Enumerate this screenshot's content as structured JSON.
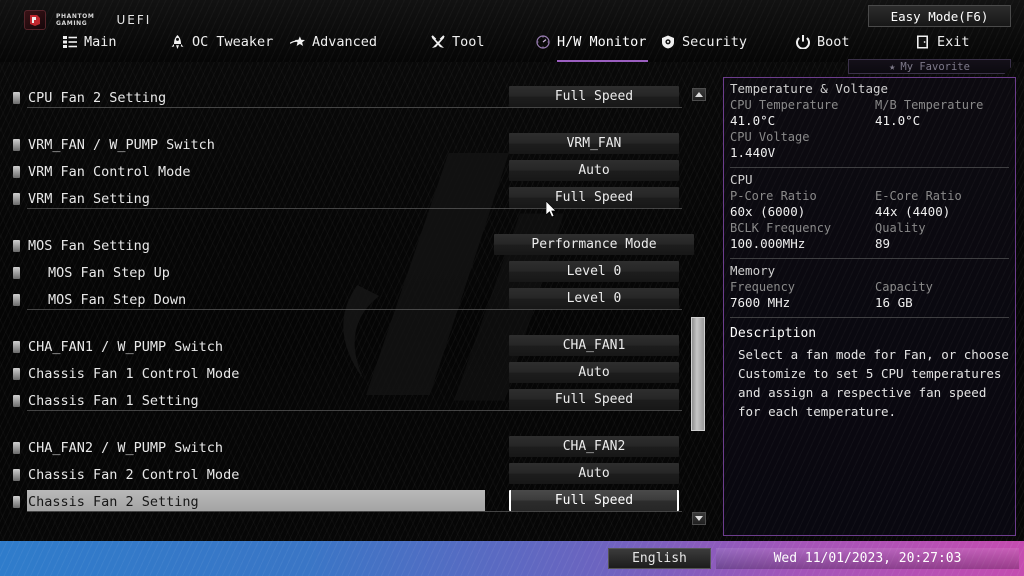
{
  "header": {
    "brand_line1": "PHANTOM",
    "brand_line2": "GAMING",
    "uefi_label": "UEFI",
    "easy_mode_label": "Easy Mode(F6)",
    "my_favorite_label": "My Favorite",
    "tabs": [
      {
        "label": "Main",
        "icon": "list-icon",
        "active": false
      },
      {
        "label": "OC Tweaker",
        "icon": "rocket-icon",
        "active": false
      },
      {
        "label": "Advanced",
        "icon": "star-icon",
        "active": false
      },
      {
        "label": "Tool",
        "icon": "tools-icon",
        "active": false
      },
      {
        "label": "H/W Monitor",
        "icon": "gauge-icon",
        "active": true
      },
      {
        "label": "Security",
        "icon": "shield-icon",
        "active": false
      },
      {
        "label": "Boot",
        "icon": "power-icon",
        "active": false
      },
      {
        "label": "Exit",
        "icon": "exit-icon",
        "active": false
      }
    ]
  },
  "settings": [
    {
      "label": "CPU Fan 2 Setting",
      "value": "Full Speed",
      "indent": false,
      "selected": false,
      "divider_after": true
    },
    {
      "label": "VRM_FAN / W_PUMP Switch",
      "value": "VRM_FAN",
      "indent": false,
      "selected": false,
      "divider_after": false
    },
    {
      "label": "VRM Fan Control Mode",
      "value": "Auto",
      "indent": false,
      "selected": false,
      "divider_after": false
    },
    {
      "label": "VRM Fan Setting",
      "value": "Full Speed",
      "indent": false,
      "selected": false,
      "divider_after": true
    },
    {
      "label": "MOS Fan Setting",
      "value": "Performance Mode",
      "indent": false,
      "selected": false,
      "divider_after": false
    },
    {
      "label": "MOS Fan Step Up",
      "value": "Level 0",
      "indent": true,
      "selected": false,
      "divider_after": false
    },
    {
      "label": "MOS Fan Step Down",
      "value": "Level 0",
      "indent": true,
      "selected": false,
      "divider_after": true
    },
    {
      "label": "CHA_FAN1 / W_PUMP Switch",
      "value": "CHA_FAN1",
      "indent": false,
      "selected": false,
      "divider_after": false
    },
    {
      "label": "Chassis Fan 1 Control Mode",
      "value": "Auto",
      "indent": false,
      "selected": false,
      "divider_after": false
    },
    {
      "label": "Chassis Fan 1 Setting",
      "value": "Full Speed",
      "indent": false,
      "selected": false,
      "divider_after": true
    },
    {
      "label": "CHA_FAN2 / W_PUMP Switch",
      "value": "CHA_FAN2",
      "indent": false,
      "selected": false,
      "divider_after": false
    },
    {
      "label": "Chassis Fan 2 Control Mode",
      "value": "Auto",
      "indent": false,
      "selected": false,
      "divider_after": false
    },
    {
      "label": "Chassis Fan 2 Setting",
      "value": "Full Speed",
      "indent": false,
      "selected": true,
      "divider_after": true
    }
  ],
  "info": {
    "temp_section_title": "Temperature & Voltage",
    "temp_rows": [
      {
        "k1": "CPU Temperature",
        "v1": "41.0°C",
        "k2": "M/B Temperature",
        "v2": "41.0°C"
      },
      {
        "k1": "CPU Voltage",
        "v1": "1.440V",
        "k2": "",
        "v2": ""
      }
    ],
    "cpu_section_title": "CPU",
    "cpu_rows": [
      {
        "k1": "P-Core Ratio",
        "v1": "60x (6000)",
        "k2": "E-Core Ratio",
        "v2": "44x (4400)"
      },
      {
        "k1": "BCLK Frequency",
        "v1": "100.000MHz",
        "k2": "Quality",
        "v2": "89"
      }
    ],
    "memory_section_title": "Memory",
    "memory_rows": [
      {
        "k1": "Frequency",
        "v1": "7600 MHz",
        "k2": "Capacity",
        "v2": "16 GB"
      }
    ],
    "description_title": "Description",
    "description_body": "Select a fan mode for Fan, or choose Customize to set 5 CPU temperatures and assign a respective fan speed for each temperature."
  },
  "bottom": {
    "language_label": "English",
    "datetime_label": "Wed 11/01/2023, 20:27:03"
  },
  "colors": {
    "accent_purple": "#9b5fc0",
    "panel_border": "#6c3d8d",
    "highlight_row": "#b9b9b9",
    "bottom_gradient_start": "#2f7ccb",
    "bottom_gradient_end": "#c44cb0"
  }
}
